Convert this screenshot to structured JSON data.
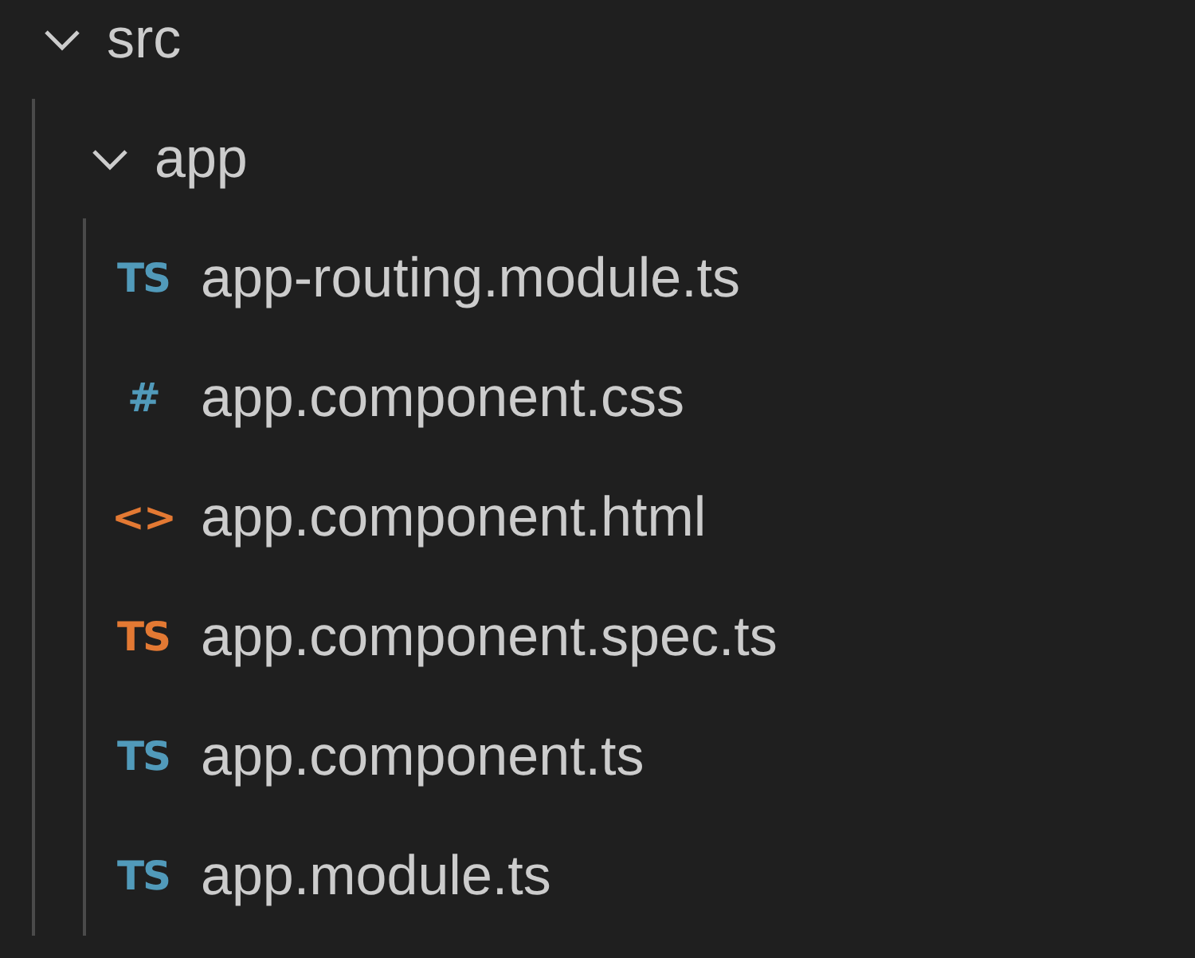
{
  "tree": [
    {
      "label": "src",
      "expanded": true,
      "children": [
        {
          "label": "app",
          "expanded": true,
          "children": [
            {
              "label": "app-routing.module.ts",
              "icon": "TS",
              "color": "#519aba"
            },
            {
              "label": "app.component.css",
              "icon": "#",
              "color": "#519aba"
            },
            {
              "label": "app.component.html",
              "icon": "<>",
              "color": "#e37933"
            },
            {
              "label": "app.component.spec.ts",
              "icon": "TS",
              "color": "#e37933"
            },
            {
              "label": "app.component.ts",
              "icon": "TS",
              "color": "#519aba"
            },
            {
              "label": "app.module.ts",
              "icon": "TS",
              "color": "#519aba"
            }
          ]
        }
      ]
    }
  ]
}
